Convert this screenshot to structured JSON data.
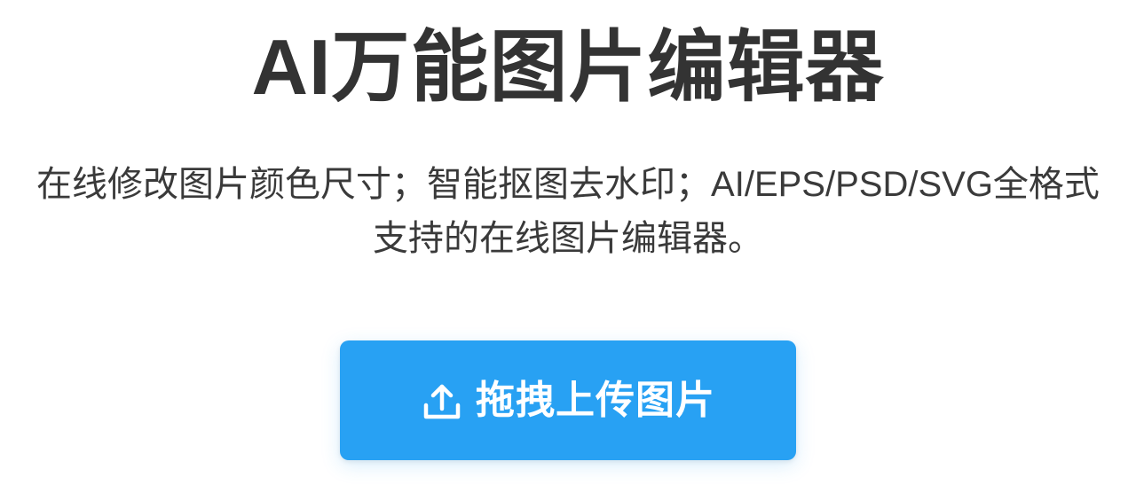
{
  "header": {
    "title": "AI万能图片编辑器",
    "subtitle": "在线修改图片颜色尺寸；智能抠图去水印；AI/EPS/PSD/SVG全格式支持的在线图片编辑器。"
  },
  "upload": {
    "label": "拖拽上传图片",
    "icon": "upload-icon"
  },
  "colors": {
    "accent": "#28a1f3",
    "title_text": "#333333",
    "body_text": "#3a3a3a",
    "button_text": "#ffffff"
  }
}
